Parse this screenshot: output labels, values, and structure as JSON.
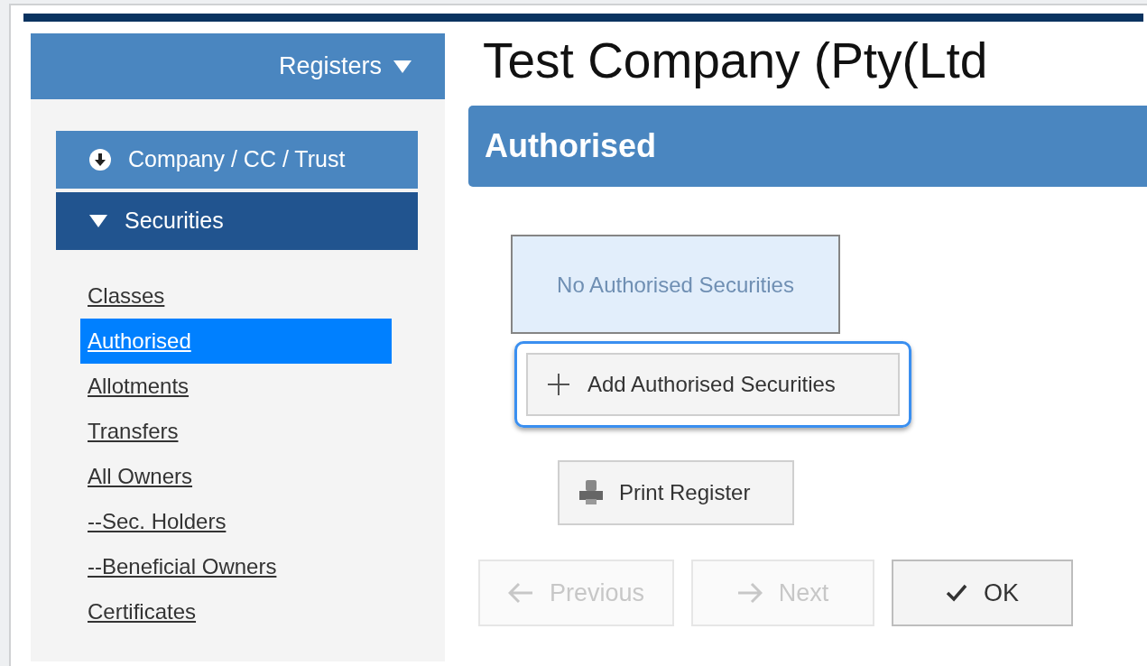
{
  "sidebar": {
    "title": "Registers",
    "sections": [
      {
        "label": "Company / CC / Trust",
        "expanded": false
      },
      {
        "label": "Securities",
        "expanded": true
      }
    ],
    "items": [
      {
        "label": "Classes",
        "selected": false
      },
      {
        "label": "Authorised",
        "selected": true
      },
      {
        "label": "Allotments",
        "selected": false
      },
      {
        "label": "Transfers",
        "selected": false
      },
      {
        "label": "All Owners",
        "selected": false
      },
      {
        "label": "--Sec. Holders",
        "selected": false
      },
      {
        "label": "--Beneficial Owners",
        "selected": false
      },
      {
        "label": "Certificates",
        "selected": false
      }
    ]
  },
  "page_title": "Test Company (Pty(Ltd",
  "section_header": "Authorised",
  "empty_message": "No Authorised Securities",
  "add_button": {
    "label": "Add Authorised Securities",
    "focused": true
  },
  "print_button": {
    "label": "Print Register"
  },
  "nav_buttons": [
    {
      "kind": "previous",
      "label": "Previous",
      "disabled": true
    },
    {
      "kind": "next",
      "label": "Next",
      "disabled": true
    },
    {
      "kind": "ok",
      "label": "OK",
      "disabled": false
    }
  ]
}
